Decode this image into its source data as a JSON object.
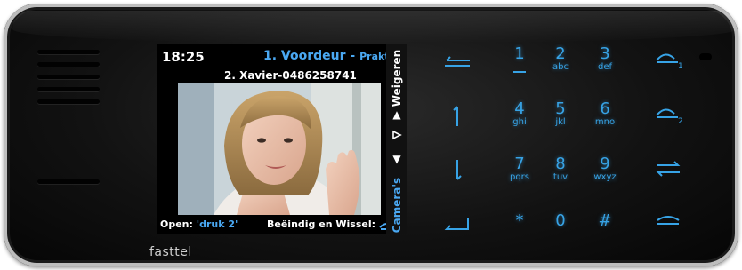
{
  "screen": {
    "time": "18:25",
    "door_title": "1. Voordeur",
    "door_sub": "Praktijk",
    "caller": "2. Xavier-0486258741",
    "open_label": "Open:",
    "open_value": "'druk 2'",
    "end_switch_label": "Beëindig en Wissel:",
    "side_reject": "Weigeren",
    "side_cameras": "Camera's"
  },
  "keypad": {
    "keys": [
      {
        "num": "1",
        "letters": ""
      },
      {
        "num": "2",
        "letters": "abc"
      },
      {
        "num": "3",
        "letters": "def"
      },
      {
        "num": "4",
        "letters": "ghi"
      },
      {
        "num": "5",
        "letters": "jkl"
      },
      {
        "num": "6",
        "letters": "mno"
      },
      {
        "num": "7",
        "letters": "pqrs"
      },
      {
        "num": "8",
        "letters": "tuv"
      },
      {
        "num": "9",
        "letters": "wxyz"
      },
      {
        "num": "*",
        "letters": ""
      },
      {
        "num": "0",
        "letters": ""
      },
      {
        "num": "#",
        "letters": ""
      }
    ],
    "handset_1_index": "1",
    "handset_2_index": "2"
  },
  "brand": "fasttel",
  "colors": {
    "accent": "#37a3e6",
    "screen_accent": "#4aa8f2",
    "body": "#121212"
  },
  "icons": [
    "back-icon",
    "arrow-up-icon",
    "arrow-down-icon",
    "enter-icon",
    "handset-1-icon",
    "handset-2-icon",
    "transfer-icon",
    "hangup-icon",
    "door-open-icon"
  ]
}
